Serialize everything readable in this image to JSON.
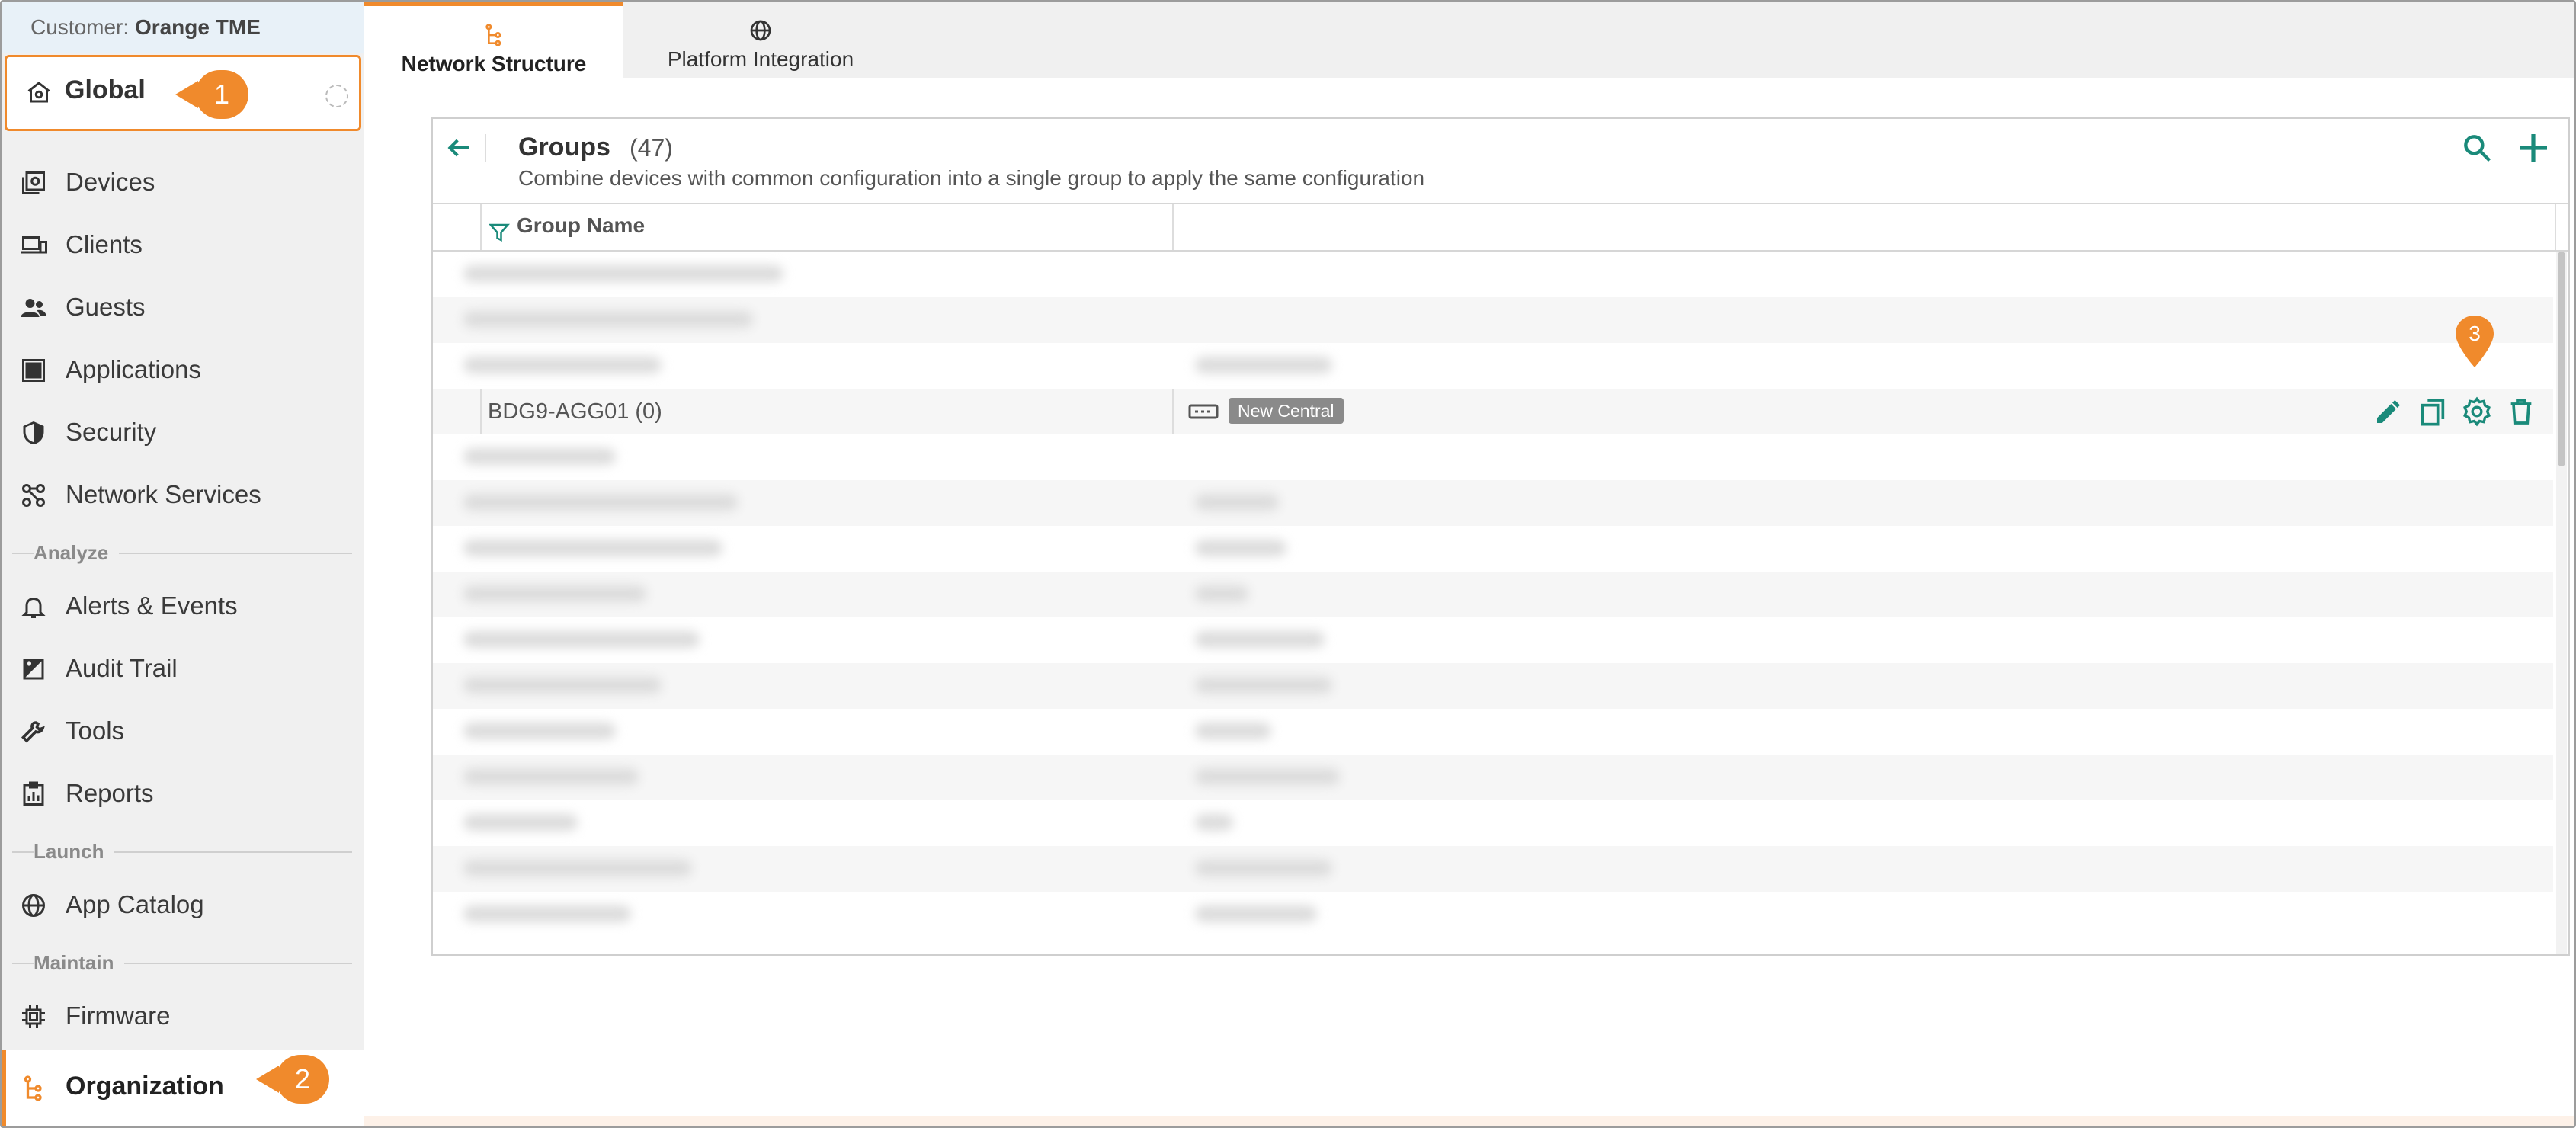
{
  "sidebar": {
    "customer_prefix": "Customer:",
    "customer_name": "Orange TME",
    "scope_label": "Global",
    "items": [
      {
        "label": "Devices",
        "icon": "devices-icon"
      },
      {
        "label": "Clients",
        "icon": "clients-icon"
      },
      {
        "label": "Guests",
        "icon": "guests-icon"
      },
      {
        "label": "Applications",
        "icon": "applications-icon"
      },
      {
        "label": "Security",
        "icon": "shield-icon"
      },
      {
        "label": "Network Services",
        "icon": "network-services-icon"
      },
      {
        "label": "Alerts & Events",
        "icon": "bell-icon"
      },
      {
        "label": "Audit Trail",
        "icon": "audit-trail-icon"
      },
      {
        "label": "Tools",
        "icon": "wrench-icon"
      },
      {
        "label": "Reports",
        "icon": "reports-icon"
      },
      {
        "label": "App Catalog",
        "icon": "globe-icon"
      },
      {
        "label": "Firmware",
        "icon": "chip-icon"
      }
    ],
    "sections": {
      "analyze": "Analyze",
      "launch": "Launch",
      "maintain": "Maintain"
    },
    "active_item": "Organization"
  },
  "callouts": {
    "one": "1",
    "two": "2",
    "three": "3"
  },
  "tabs": [
    {
      "label": "Network Structure",
      "active": true
    },
    {
      "label": "Platform Integration",
      "active": false
    }
  ],
  "panel": {
    "title": "Groups",
    "count": "(47)",
    "subtitle": "Combine devices with common configuration into a single group to apply the same configuration",
    "column_header": "Group Name"
  },
  "selected_row": {
    "group_name": "BDG9-AGG01 (0)",
    "badge": "New Central",
    "actions": [
      "edit-icon",
      "copy-icon",
      "gear-icon",
      "trash-icon"
    ]
  },
  "colors": {
    "accent": "#f08a2c",
    "teal": "#1a8a7a",
    "badge": "#8a8a8a"
  }
}
